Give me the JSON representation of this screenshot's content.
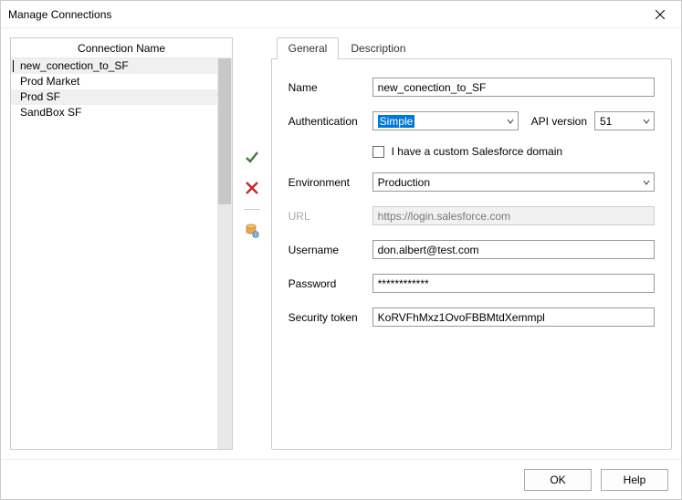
{
  "window": {
    "title": "Manage Connections"
  },
  "connections": {
    "header": "Connection Name",
    "items": [
      {
        "name": "new_conection_to_SF"
      },
      {
        "name": "Prod Market"
      },
      {
        "name": "Prod SF"
      },
      {
        "name": "SandBox SF"
      }
    ]
  },
  "tabs": {
    "general": "General",
    "description": "Description"
  },
  "form": {
    "name_label": "Name",
    "name_value": "new_conection_to_SF",
    "auth_label": "Authentication",
    "auth_value": "Simple",
    "api_label": "API version",
    "api_value": "51",
    "custom_domain_label": "I have a custom Salesforce domain",
    "env_label": "Environment",
    "env_value": "Production",
    "url_label": "URL",
    "url_value": "https://login.salesforce.com",
    "user_label": "Username",
    "user_value": "don.albert@test.com",
    "pass_label": "Password",
    "pass_value": "************",
    "token_label": "Security token",
    "token_value": "KoRVFhMxz1OvoFBBMtdXemmpl"
  },
  "buttons": {
    "ok": "OK",
    "help": "Help"
  }
}
